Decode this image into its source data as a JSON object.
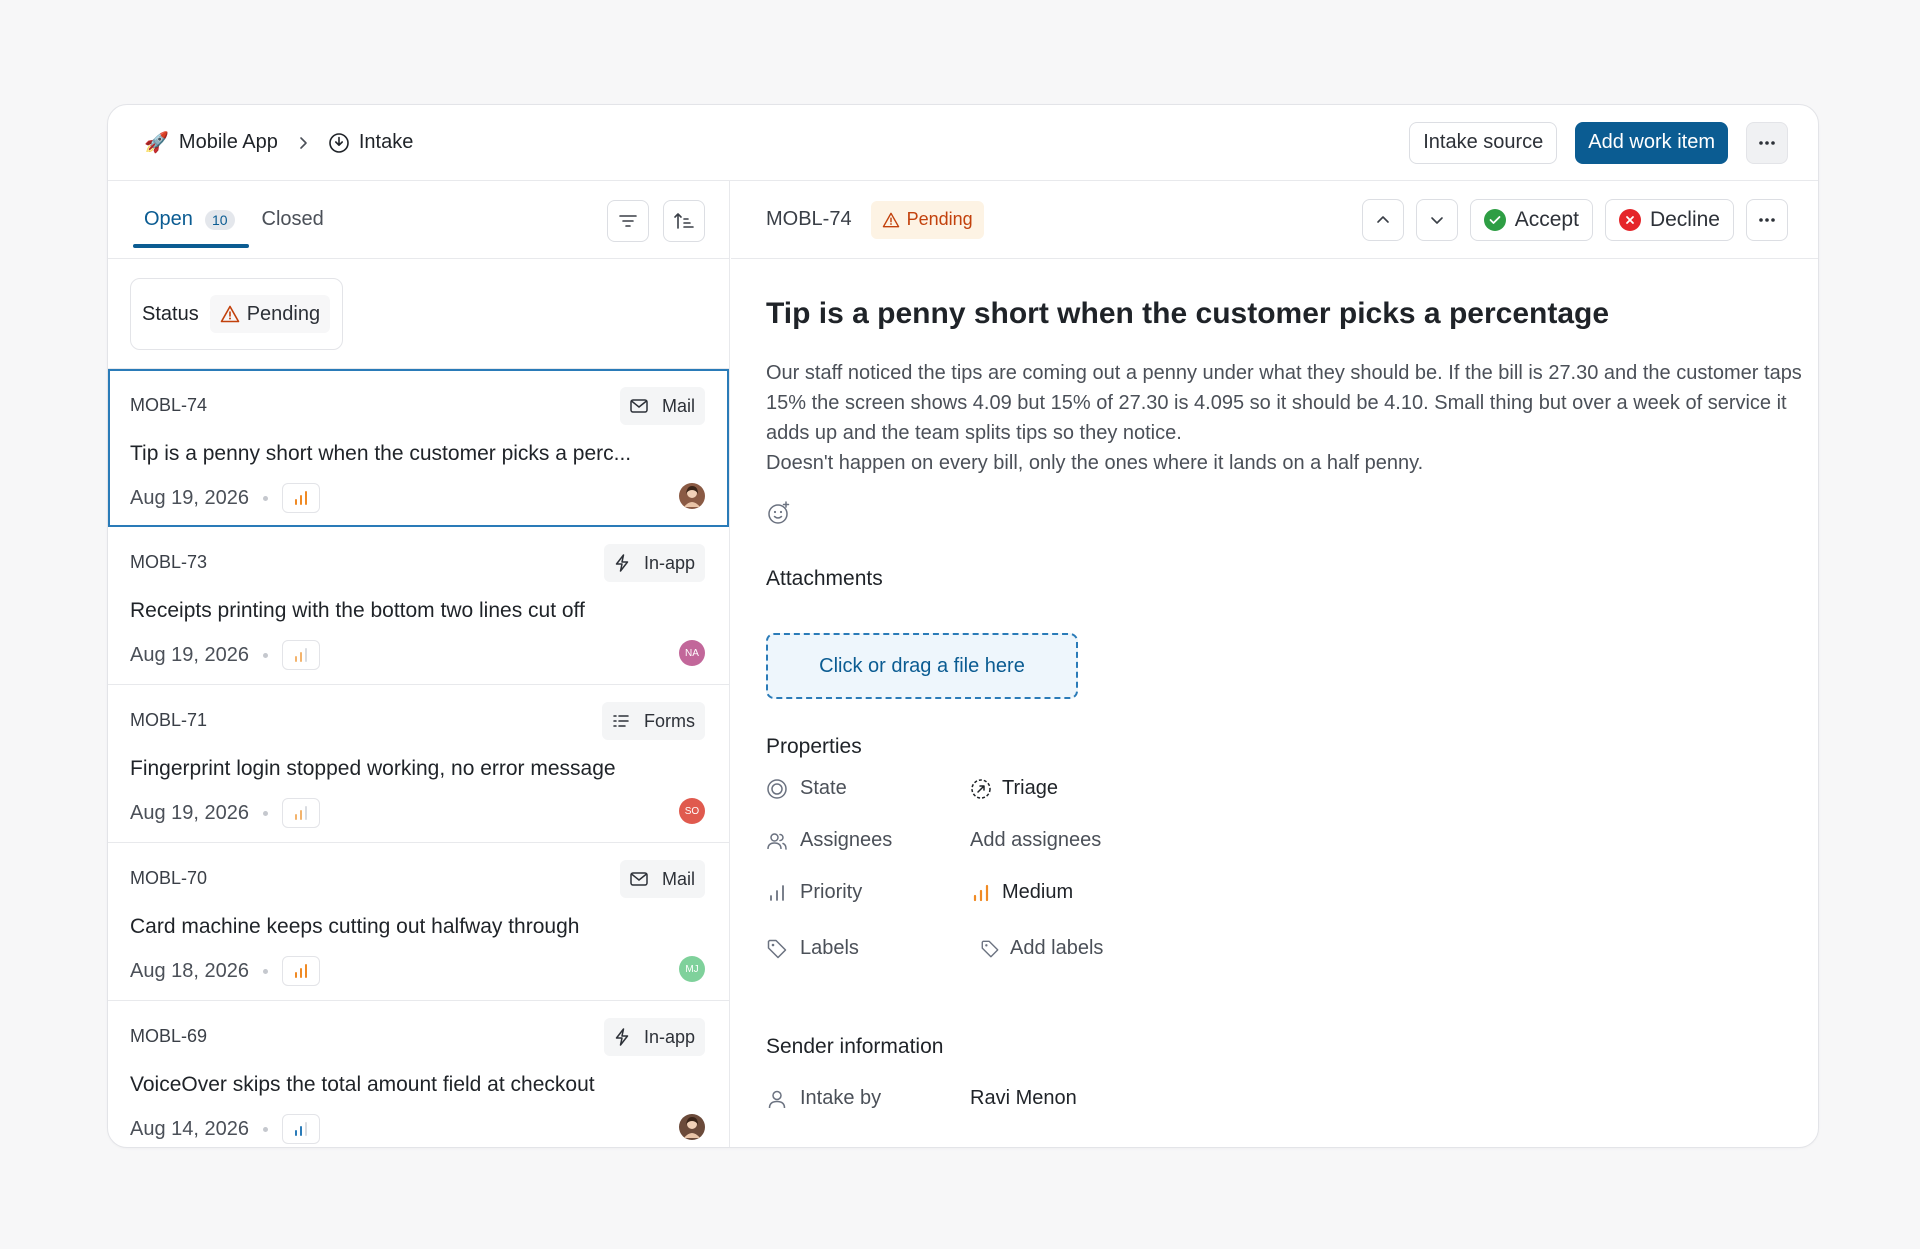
{
  "breadcrumb": {
    "project": "Mobile App",
    "section": "Intake"
  },
  "topbar": {
    "intake_source_label": "Intake source",
    "add_work_item_label": "Add work item"
  },
  "tabs": {
    "open_label": "Open",
    "open_count": "10",
    "closed_label": "Closed"
  },
  "filter": {
    "status_label": "Status",
    "status_value": "Pending"
  },
  "items": [
    {
      "id": "MOBL-74",
      "source": "Mail",
      "source_icon": "mail-icon",
      "title": "Tip is a penny short when the customer picks a perc...",
      "date": "Aug 19, 2026",
      "priority": "medium",
      "avatar": "",
      "avatar_color": "#8a5a44",
      "selected": true
    },
    {
      "id": "MOBL-73",
      "source": "In-app",
      "source_icon": "bolt-icon",
      "title": "Receipts printing with the bottom two lines cut off",
      "date": "Aug 19, 2026",
      "priority": "low",
      "avatar": "NA",
      "avatar_color": "#c2679a"
    },
    {
      "id": "MOBL-71",
      "source": "Forms",
      "source_icon": "form-icon",
      "title": "Fingerprint login stopped working, no error message",
      "date": "Aug 19, 2026",
      "priority": "low",
      "avatar": "SO",
      "avatar_color": "#e05a4e"
    },
    {
      "id": "MOBL-70",
      "source": "Mail",
      "source_icon": "mail-icon",
      "title": "Card machine keeps cutting out halfway through",
      "date": "Aug 18, 2026",
      "priority": "medium",
      "avatar": "MJ",
      "avatar_color": "#7fd19b"
    },
    {
      "id": "MOBL-69",
      "source": "In-app",
      "source_icon": "bolt-icon",
      "title": "VoiceOver skips the total amount field at checkout",
      "date": "Aug 14, 2026",
      "priority": "low-blue",
      "avatar": "",
      "avatar_color": "#6b4a3a"
    }
  ],
  "detail": {
    "id": "MOBL-74",
    "status": "Pending",
    "accept_label": "Accept",
    "decline_label": "Decline",
    "title": "Tip is a penny short when the customer picks a percentage",
    "paragraph1": "Our staff noticed the tips are coming out a penny under what they should be. If the bill is 27.30 and the customer taps 15% the screen shows 4.09 but 15% of 27.30 is 4.095 so it should be 4.10. Small thing but over a week of service it adds up and the team splits tips so they notice.",
    "paragraph2": "Doesn't happen on every bill, only the ones where it lands on a half penny.",
    "attachments_title": "Attachments",
    "dropzone_label": "Click or drag a file here",
    "properties_title": "Properties",
    "properties": {
      "state_label": "State",
      "state_value": "Triage",
      "assignees_label": "Assignees",
      "assignees_value": "Add assignees",
      "priority_label": "Priority",
      "priority_value": "Medium",
      "labels_label": "Labels",
      "labels_value": "Add labels"
    },
    "sender_title": "Sender information",
    "intake_by_label": "Intake by",
    "intake_by_value": "Ravi Menon"
  },
  "colors": {
    "accent": "#0b5c92",
    "pending": "#c2410c",
    "accept": "#2e9e44",
    "decline": "#e5252a",
    "priority_medium": "#f08a24"
  }
}
